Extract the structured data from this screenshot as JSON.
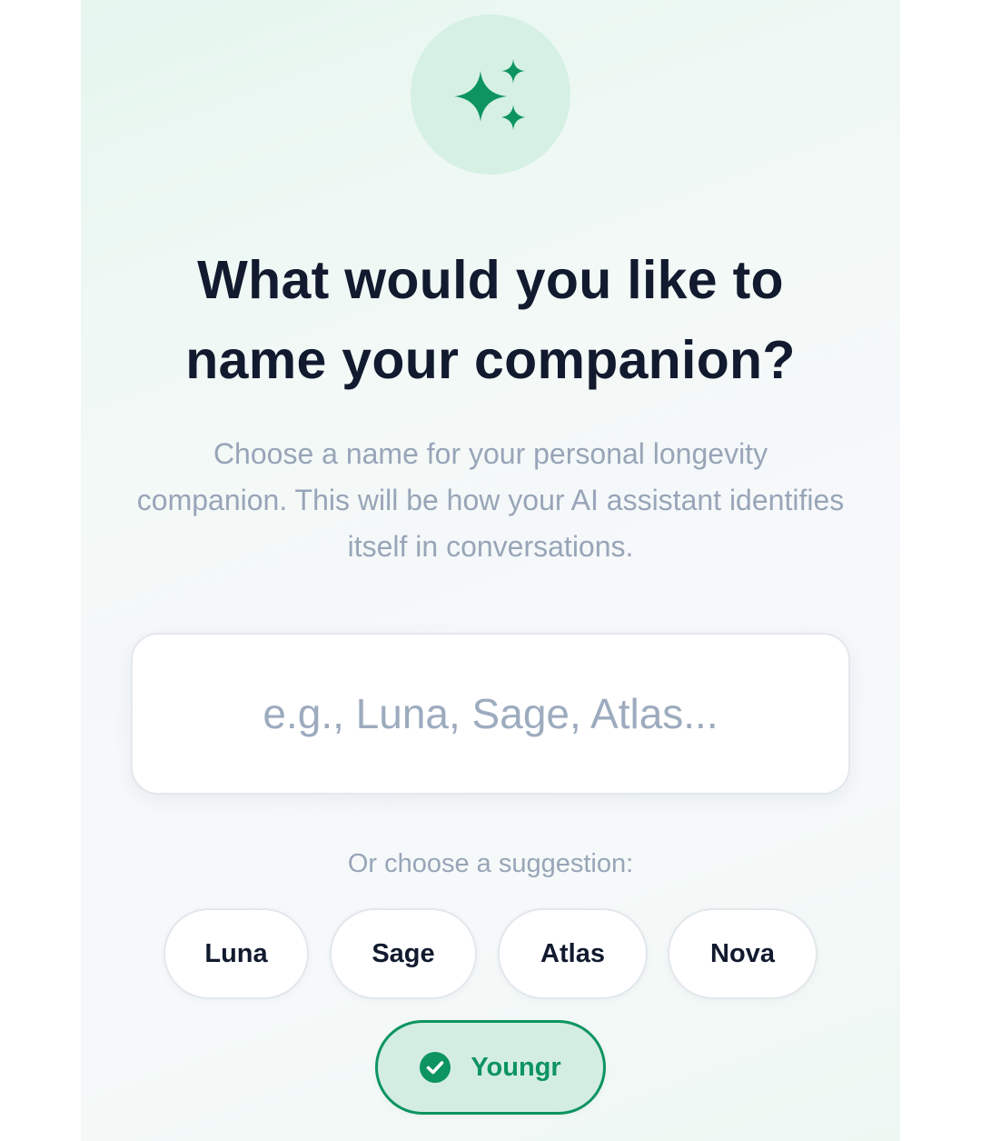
{
  "hero": {
    "icon": "sparkles-icon",
    "accent_color": "#0d9460"
  },
  "heading": {
    "line1": "What would you like to",
    "line2": "name your companion?"
  },
  "subtitle": "Choose a name for your personal longevity companion. This will be how your AI assistant identifies itself in conversations.",
  "name_input": {
    "value": "",
    "placeholder": "e.g., Luna, Sage, Atlas..."
  },
  "suggestions": {
    "label": "Or choose a suggestion:",
    "items": [
      "Luna",
      "Sage",
      "Atlas",
      "Nova",
      "Youngr"
    ],
    "selected": "Youngr",
    "selected_icon": "check-circle-icon"
  }
}
